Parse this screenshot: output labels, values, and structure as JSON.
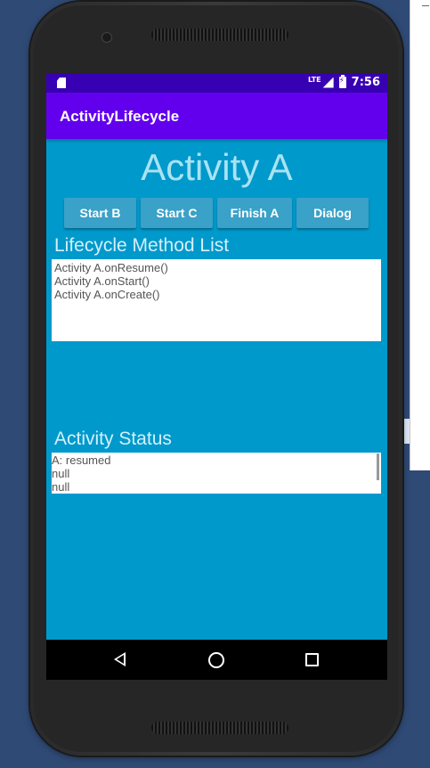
{
  "statusbar": {
    "network": "LTE",
    "time": "7:56"
  },
  "appbar": {
    "title": "ActivityLifecycle"
  },
  "main": {
    "heading": "Activity A",
    "buttons": [
      "Start B",
      "Start C",
      "Finish A",
      "Dialog"
    ],
    "method_list_label": "Lifecycle Method List",
    "method_list": [
      "Activity A.onResume()",
      "Activity A.onStart()",
      "Activity A.onCreate()"
    ],
    "status_label": "Activity Status",
    "status_lines": [
      "A: resumed",
      "null",
      "null"
    ]
  },
  "navbar": {
    "back": "back-icon",
    "home": "home-icon",
    "recents": "recents-icon"
  },
  "colors": {
    "statusbar": "#3700b3",
    "appbar": "#6200ee",
    "content": "#0099cc",
    "button": "#3aa1c8"
  }
}
